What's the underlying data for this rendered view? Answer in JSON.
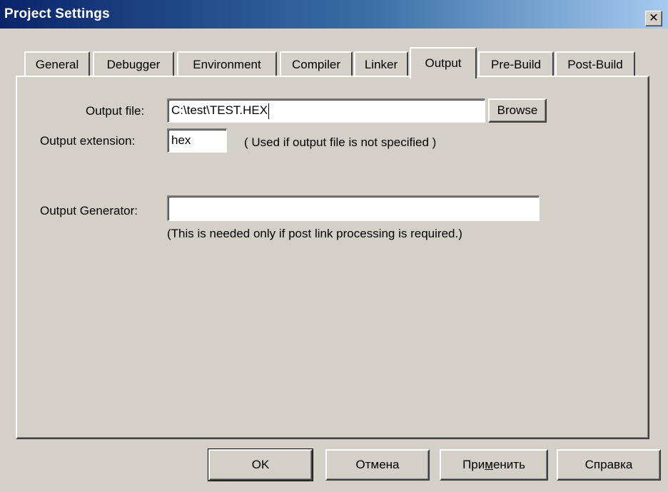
{
  "window": {
    "title": "Project Settings",
    "close_glyph": "✕"
  },
  "tabs": [
    {
      "label": "General"
    },
    {
      "label": "Debugger"
    },
    {
      "label": "Environment"
    },
    {
      "label": "Compiler"
    },
    {
      "label": "Linker"
    },
    {
      "label": "Output",
      "active": true
    },
    {
      "label": "Pre-Build"
    },
    {
      "label": "Post-Build"
    }
  ],
  "output_tab": {
    "output_file_label": "Output file:",
    "output_file_value": "C:\\test\\TEST.HEX",
    "browse_label": "Browse",
    "output_extension_label": "Output extension:",
    "output_extension_value": "hex",
    "extension_hint": "( Used if output file is not specified )",
    "output_generator_label": "Output Generator:",
    "output_generator_value": "",
    "generator_hint": "(This is needed only if post link processing is required.)"
  },
  "buttons": {
    "ok": "OK",
    "cancel": "Отмена",
    "apply_before": "При",
    "apply_mnemonic": "м",
    "apply_after": "енить",
    "help": "Справка"
  },
  "colors": {
    "face": "#d4d0c8",
    "title_start": "#0a246a",
    "title_end": "#a6caf0"
  }
}
